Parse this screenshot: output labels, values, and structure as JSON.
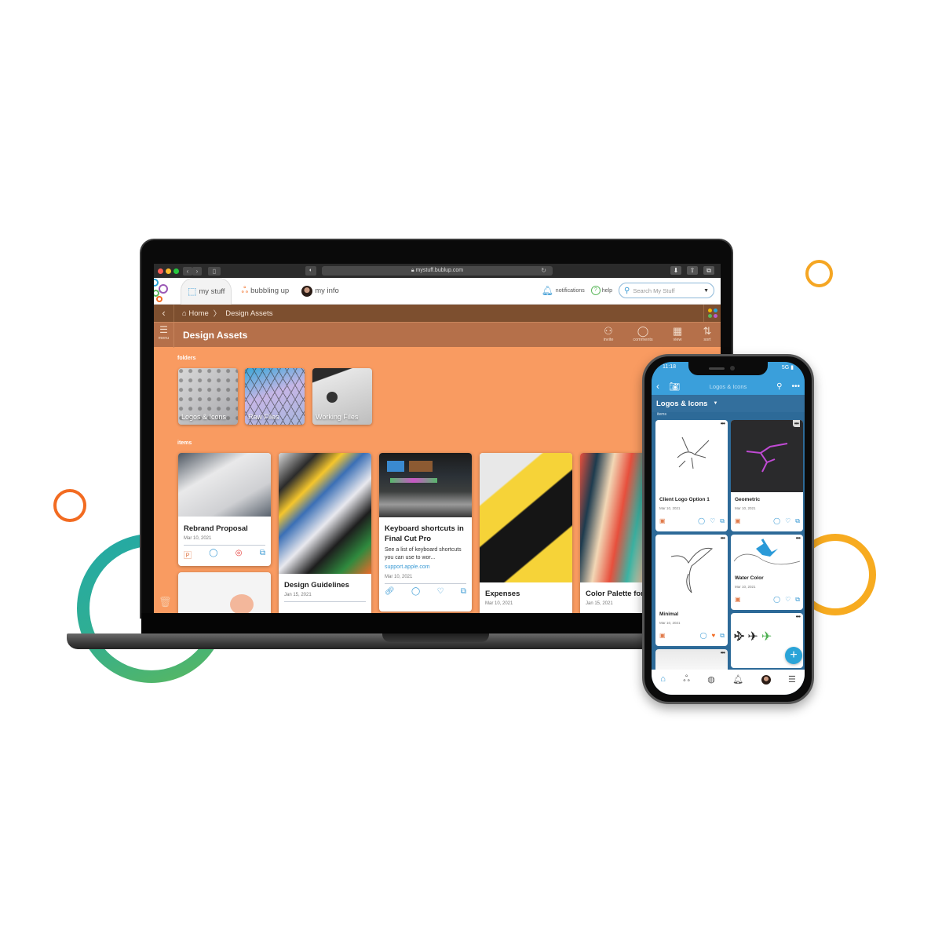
{
  "browser": {
    "url": "mystuff.bublup.com"
  },
  "app_nav": {
    "tabs": [
      {
        "label": "my stuff",
        "icon": "box-icon"
      },
      {
        "label": "bubbling up",
        "icon": "bubbles-icon"
      },
      {
        "label": "my info",
        "icon": "avatar"
      }
    ],
    "notifications_label": "notifications",
    "help_label": "help",
    "search_placeholder": "Search My Stuff"
  },
  "breadcrumb": {
    "home": "Home",
    "separator": "〉",
    "current": "Design Assets"
  },
  "titlebar": {
    "menu_label": "menu",
    "title": "Design Assets",
    "actions": [
      {
        "label": "invite",
        "icon": "invite-icon"
      },
      {
        "label": "comments",
        "icon": "comment-icon"
      },
      {
        "label": "view",
        "icon": "view-icon"
      },
      {
        "label": "sort",
        "icon": "sort-icon"
      }
    ]
  },
  "content": {
    "folders_label": "folders",
    "items_label": "items",
    "folders": [
      {
        "name": "Logos & Icons"
      },
      {
        "name": "Raw Files"
      },
      {
        "name": "Working Files"
      }
    ],
    "items": [
      {
        "title": "Rebrand Proposal",
        "date": "Mar 10, 2021"
      },
      {
        "title": "Design Guidelines",
        "date": "Jan 15, 2021"
      },
      {
        "title": "Keyboard shortcuts in Final Cut Pro",
        "description": "See a list of keyboard shortcuts you can use to wor...",
        "link": "support.apple.com",
        "date": "Mar 10, 2021"
      },
      {
        "title": "Expenses",
        "date": "Mar 10, 2021"
      },
      {
        "title": "Color Palette for",
        "date": "Jan 15, 2021"
      }
    ]
  },
  "phone": {
    "time": "11:18",
    "signal": "5G",
    "toolbar_title": "Logos & Icons",
    "header_title": "Logos & Icons",
    "items_label": "items",
    "items": [
      {
        "title": "Client Logo Option 1",
        "date": "Mar 10, 2021"
      },
      {
        "title": "Geometric",
        "date": "Mar 10, 2021"
      },
      {
        "title": "Minimal",
        "date": "Mar 10, 2021"
      },
      {
        "title": "Water Color",
        "date": "Mar 10, 2021"
      }
    ],
    "tabbar": [
      "my-stuff",
      "bubbling-up",
      "explore",
      "notifications",
      "profile",
      "menu"
    ]
  },
  "colors": {
    "accent_orange": "#f99b61",
    "breadcrumb_brown": "#7d4f2f",
    "title_brown": "#b5704a",
    "link_blue": "#3a9ad4",
    "phone_blue": "#3a9fdb",
    "phone_dark_blue": "#2d6a98"
  }
}
